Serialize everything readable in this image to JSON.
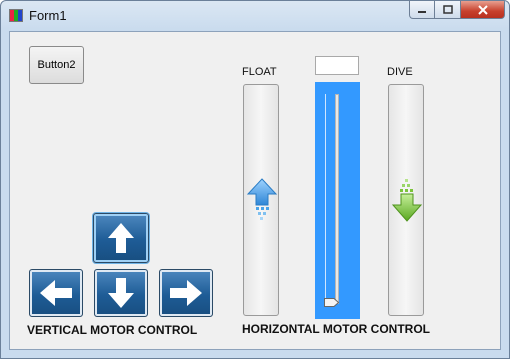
{
  "window": {
    "title": "Form1",
    "icon": "form-app-icon"
  },
  "controls": {
    "button2_label": "Button2",
    "float_label": "FLOAT",
    "dive_label": "DIVE",
    "vertical_label": "VERTICAL MOTOR CONTROL",
    "horizontal_label": "HORIZONTAL MOTOR CONTROL",
    "numeric_value": ""
  },
  "arrows": {
    "up": "up-arrow-icon",
    "down": "down-arrow-icon",
    "left": "left-arrow-icon",
    "right": "right-arrow-icon"
  },
  "trackbar": {
    "value_fraction": 0.0,
    "selection_color": "#3399ff"
  },
  "colors": {
    "float_arrow": "#4aa3e8",
    "dive_arrow": "#7cc43a",
    "arrow_button": "#1e5c96"
  }
}
